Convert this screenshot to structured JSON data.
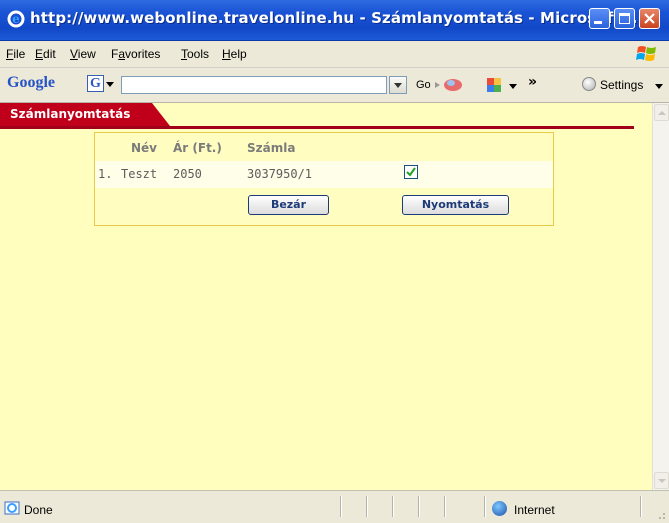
{
  "window": {
    "title": "http://www.webonline.travelonline.hu - Számlanyomtatás - Microsoft ...",
    "icon": "ie-icon"
  },
  "menu": {
    "file": {
      "pre": "",
      "u": "F",
      "post": "ile"
    },
    "edit": {
      "pre": "",
      "u": "E",
      "post": "dit"
    },
    "view": {
      "pre": "",
      "u": "V",
      "post": "iew"
    },
    "favorites": {
      "pre": "F",
      "u": "a",
      "post": "vorites"
    },
    "tools": {
      "pre": "",
      "u": "T",
      "post": "ools"
    },
    "help": {
      "pre": "",
      "u": "H",
      "post": "elp"
    }
  },
  "google_toolbar": {
    "logo": "Google",
    "g_icon": "G",
    "search_value": "",
    "go_label": "Go",
    "more": "»",
    "settings_label": "Settings"
  },
  "page": {
    "tab_title": "Számlanyomtatás",
    "table": {
      "headers": {
        "name": "Név",
        "price": "Ár (Ft.)",
        "invoice": "Számla"
      },
      "rows": [
        {
          "index": "1.",
          "name": "Teszt",
          "price": "2050",
          "invoice": "3037950/1",
          "checked": true
        }
      ]
    },
    "buttons": {
      "close": "Bezár",
      "print": "Nyomtatás"
    }
  },
  "status": {
    "text": "Done",
    "zone": "Internet"
  },
  "colors": {
    "page_bg": "#fffebe",
    "tab_red": "#c0001a",
    "box_border": "#e8c94c",
    "title_blue": "#1a54d6"
  }
}
